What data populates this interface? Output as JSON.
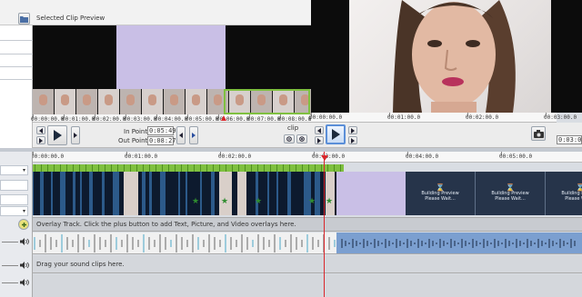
{
  "toolbar": {
    "title": "Selected Clip Preview"
  },
  "preview_left": {
    "ruler_labels": [
      "00:00:00.0",
      "00:01:00.0",
      "00:02:00.0",
      "00:03:00.0",
      "00:04:00.0",
      "00:05:00.0",
      "00:06:00.0",
      "00:07:00.0",
      "00:08:00.0",
      "00:09:00.0"
    ],
    "in_point_label": "In Point",
    "in_point_value": "0:05:49.5",
    "out_point_label": "Out Point",
    "out_point_value": "0:08:27.3",
    "tab_label": "clip"
  },
  "preview_right": {
    "ruler_labels": [
      "00:00:00.0",
      "00:01:00.0",
      "00:02:00.0",
      "00:03:00.0"
    ],
    "sequence_label": "sequence",
    "time_value": "0:03:03.1"
  },
  "timeline": {
    "ruler_labels": [
      "00:00:00.0",
      "00:01:00.0",
      "00:02:00.0",
      "00:03:00.0",
      "00:04:00.0",
      "00:05:00.0"
    ],
    "placeholder_text": [
      "Building Preview",
      "Please Wait..."
    ],
    "overlay_text": "Overlay Track. Click the plus button to add Text, Picture, and Video overlays here.",
    "sound_text": "Drag your sound clips here."
  },
  "colors": {
    "lavender": "#c9bfe6",
    "green": "#7fc040",
    "playhead": "#d9262b",
    "audio_blue": "#7b9fd0",
    "video_dark": "#0d1a2e"
  },
  "icons": [
    "folder-icon",
    "play-icon",
    "step-back-icon",
    "step-forward-icon",
    "camera-icon",
    "zoom-out-icon",
    "zoom-in-icon",
    "star-icon",
    "speaker-icon",
    "plus-icon"
  ]
}
